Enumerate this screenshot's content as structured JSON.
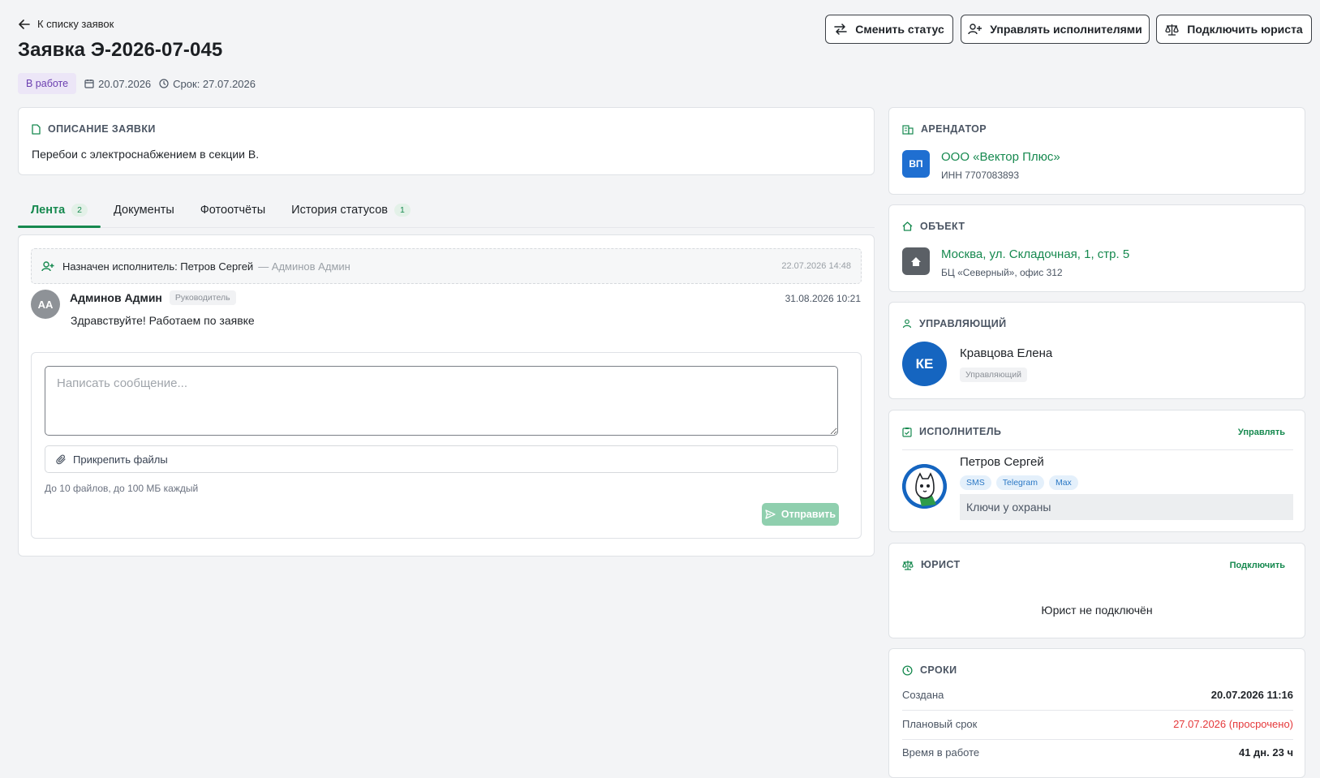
{
  "header": {
    "back_label": "К списку заявок",
    "title": "Заявка Э-2026-07-045",
    "status": "В работе",
    "created_date": "20.07.2026",
    "deadline": "Срок: 27.07.2026",
    "buttons": {
      "change_status": "Сменить статус",
      "manage_executors": "Управлять исполнителями",
      "connect_lawyer": "Подключить юриста"
    }
  },
  "description": {
    "title": "Описание заявки",
    "text": "Перебои с электроснабжением в секции В."
  },
  "tabs": [
    {
      "label": "Лента",
      "count": "2"
    },
    {
      "label": "Документы"
    },
    {
      "label": "Фотоотчёты"
    },
    {
      "label": "История статусов",
      "count": "1"
    }
  ],
  "feed": {
    "event": {
      "text": "Назначен исполнитель: Петров Сергей",
      "author": "— Админов Админ",
      "time": "22.07.2026 14:48"
    },
    "message": {
      "initials": "АА",
      "author": "Админов Админ",
      "role": "Руководитель",
      "time": "31.08.2026 10:21",
      "text": "Здравствуйте! Работаем по заявке"
    }
  },
  "composer": {
    "placeholder": "Написать сообщение...",
    "attach_label": "Прикрепить файлы",
    "hint": "До 10 файлов, до 100 МБ каждый",
    "send_label": "Отправить"
  },
  "tenant": {
    "title": "Арендатор",
    "initials": "ВП",
    "name": "ООО «Вектор Плюс»",
    "inn": "ИНН 7707083893"
  },
  "object": {
    "title": "Объект",
    "address": "Москва, ул. Складочная, 1, стр. 5",
    "sub": "БЦ «Северный», офис 312"
  },
  "manager": {
    "title": "Управляющий",
    "initials": "КЕ",
    "name": "Кравцова Елена",
    "role": "Управляющий"
  },
  "executor": {
    "title": "Исполнитель",
    "manage_label": "Управлять",
    "name": "Петров Сергей",
    "channels": [
      "SMS",
      "Telegram",
      "Max"
    ],
    "note": "Ключи у охраны"
  },
  "lawyer": {
    "title": "Юрист",
    "connect_label": "Подключить",
    "empty": "Юрист не подключён"
  },
  "deadlines": {
    "title": "Сроки",
    "rows": [
      {
        "label": "Создана",
        "value": "20.07.2026 11:16"
      },
      {
        "label": "Плановый срок",
        "value": "27.07.2026 (просрочено)"
      },
      {
        "label": "Время в работе",
        "value": "41 дн. 23 ч"
      }
    ]
  },
  "colors": {
    "accent": "#16894f",
    "overdue": "#e5393b",
    "status_bg": "#ece6f7",
    "status_text": "#6b3fb0",
    "tenant_avatar": "#1f6fd1",
    "manager_avatar": "#1565c0"
  }
}
